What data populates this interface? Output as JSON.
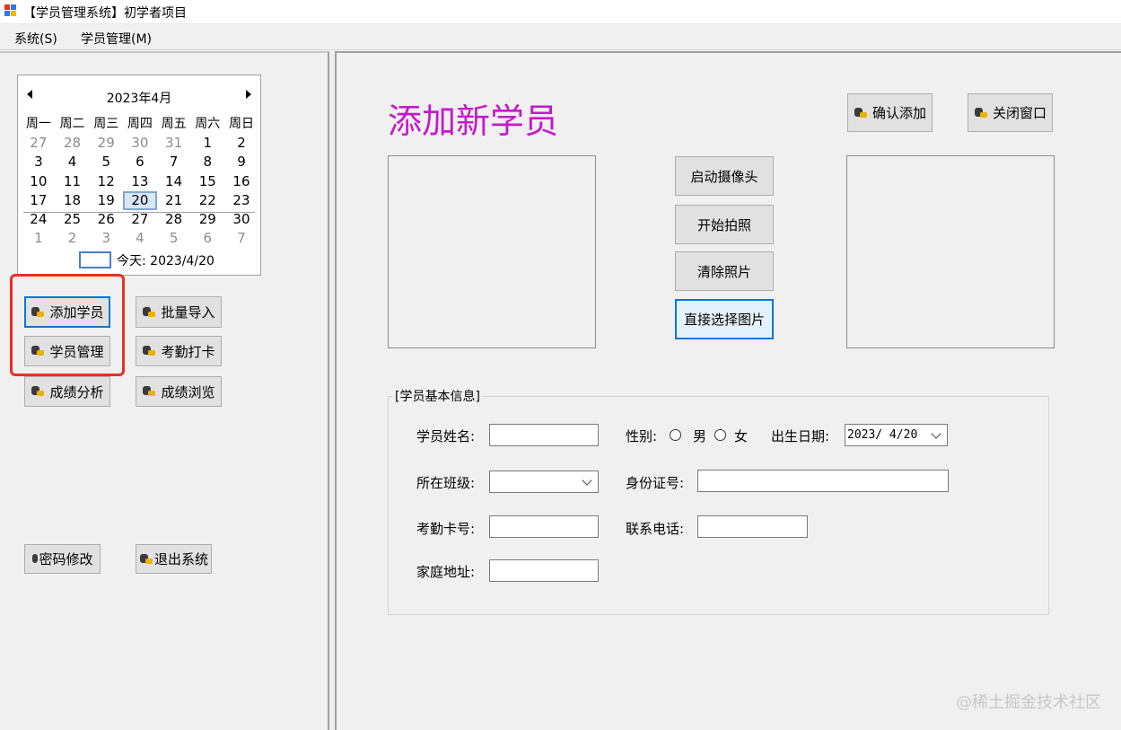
{
  "window": {
    "title": "【学员管理系统】初学者项目"
  },
  "menu": [
    {
      "label": "系统(S)"
    },
    {
      "label": "学员管理(M)"
    }
  ],
  "calendar": {
    "month_label": "2023年4月",
    "weekdays": [
      "周一",
      "周二",
      "周三",
      "周四",
      "周五",
      "周六",
      "周日"
    ],
    "weeks": [
      [
        "27",
        "28",
        "29",
        "30",
        "31",
        "1",
        "2"
      ],
      [
        "3",
        "4",
        "5",
        "6",
        "7",
        "8",
        "9"
      ],
      [
        "10",
        "11",
        "12",
        "13",
        "14",
        "15",
        "16"
      ],
      [
        "17",
        "18",
        "19",
        "20",
        "21",
        "22",
        "23"
      ],
      [
        "24",
        "25",
        "26",
        "27",
        "28",
        "29",
        "30"
      ],
      [
        "1",
        "2",
        "3",
        "4",
        "5",
        "6",
        "7"
      ]
    ],
    "selected_day": "20",
    "today_label": "今天: 2023/4/20"
  },
  "nav_buttons": {
    "add_student": "添加学员",
    "batch_import": "批量导入",
    "student_manage": "学员管理",
    "attendance": "考勤打卡",
    "score_analysis": "成绩分析",
    "score_browse": "成绩浏览",
    "change_password": "密码修改",
    "exit_system": "退出系统"
  },
  "form": {
    "title": "添加新学员",
    "confirm_button": "确认添加",
    "close_button": "关闭窗口",
    "start_camera": "启动摄像头",
    "take_photo": "开始拍照",
    "clear_photo": "清除照片",
    "choose_picture": "直接选择图片",
    "group_title": "[学员基本信息]",
    "labels": {
      "name": "学员姓名:",
      "gender": "性别:",
      "male": "男",
      "female": "女",
      "birth": "出生日期:",
      "class": "所在班级:",
      "id_card": "身份证号:",
      "card_no": "考勤卡号:",
      "phone": "联系电话:",
      "address": "家庭地址:"
    },
    "values": {
      "birth_date": "2023/ 4/20",
      "name": "",
      "class": "",
      "id_card": "",
      "card_no": "",
      "phone": "",
      "address": ""
    }
  },
  "watermark": "@稀土掘金技术社区",
  "colors": {
    "title": "#c21bc9",
    "highlight_box": "#e83024",
    "focus_border": "#0078d7"
  },
  "icons": {
    "app": "app-icon",
    "button": "key-icon"
  }
}
